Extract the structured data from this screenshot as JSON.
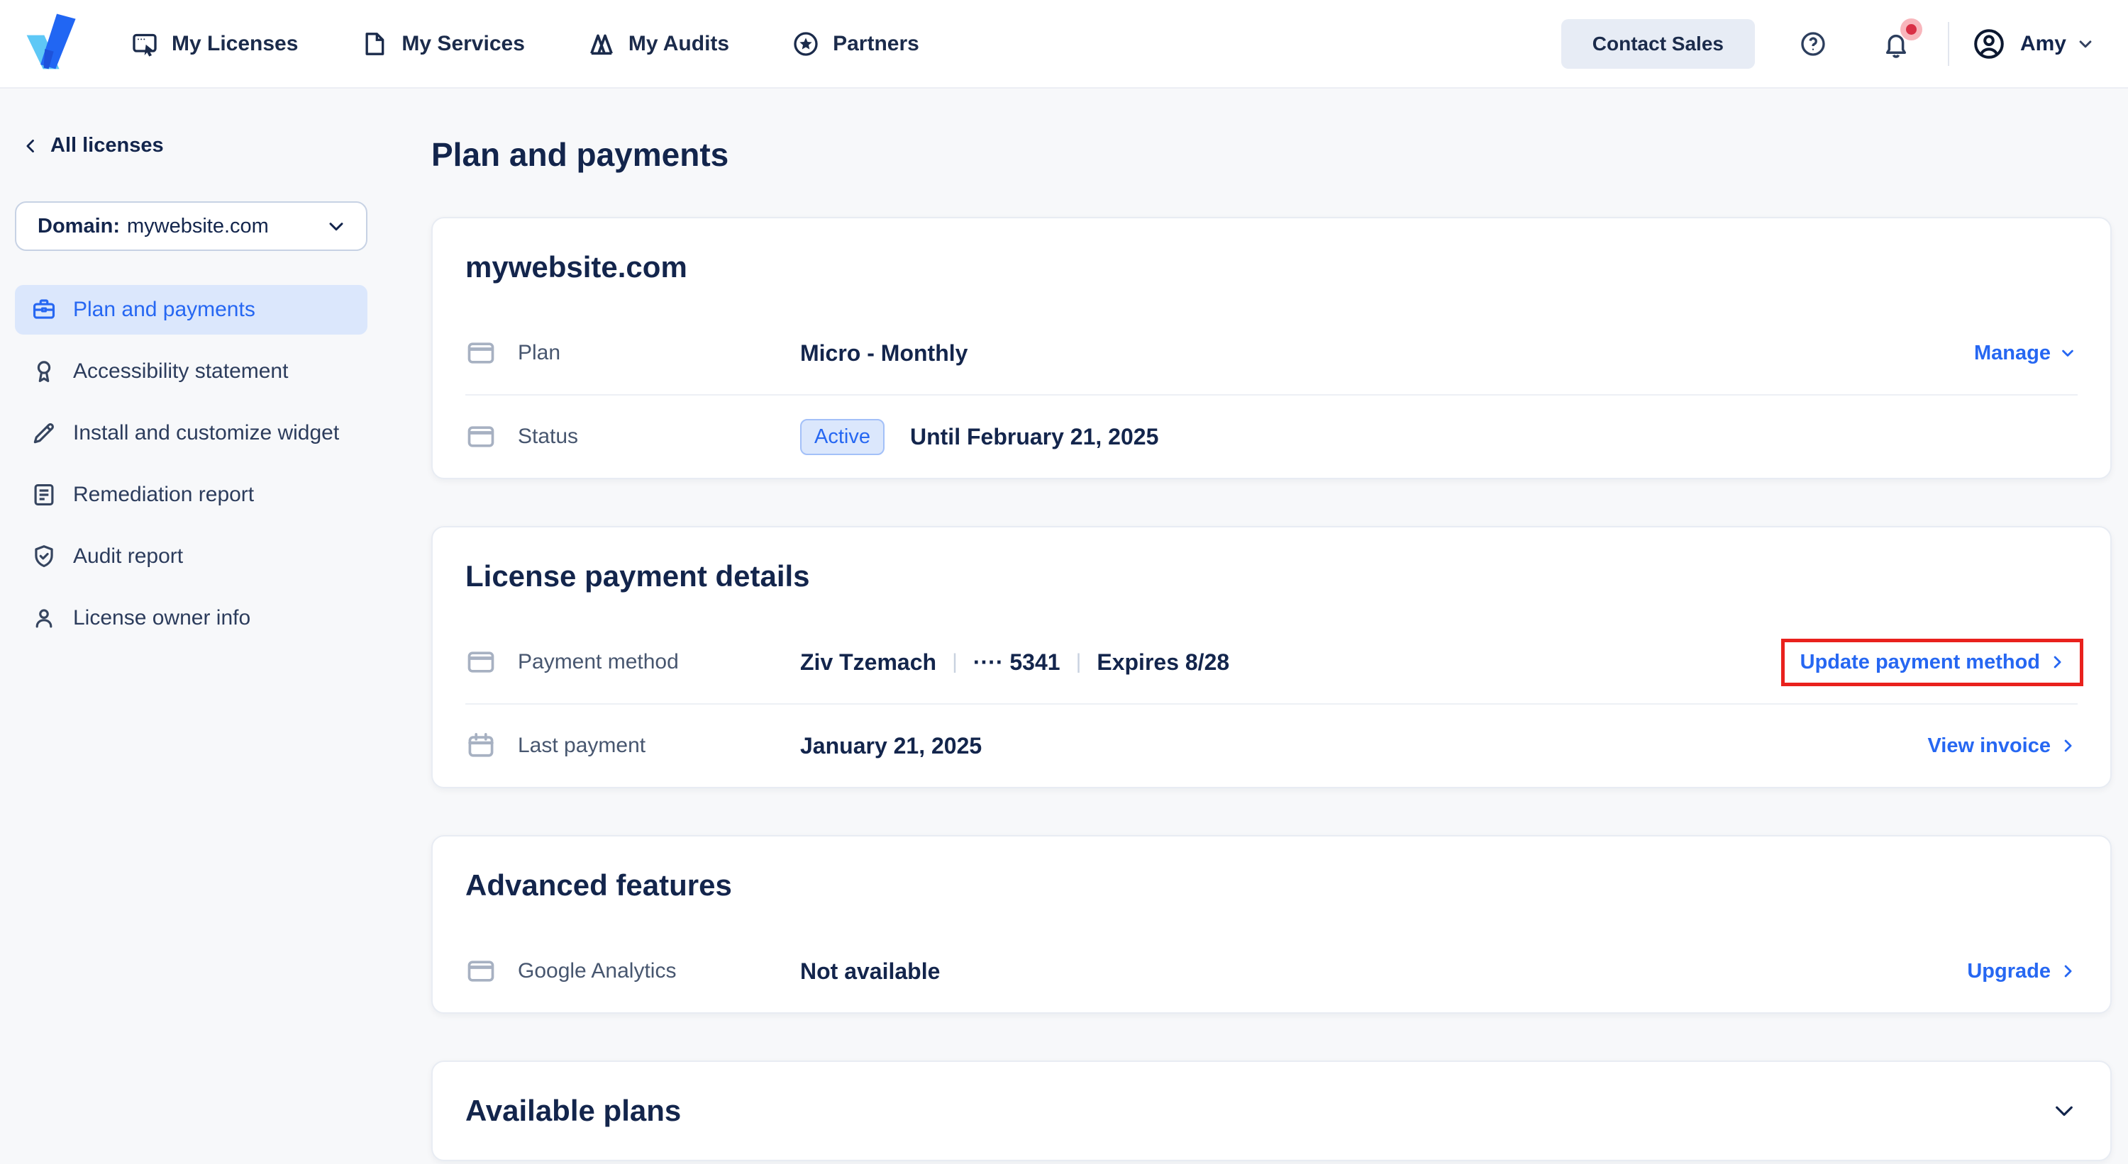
{
  "header": {
    "nav": [
      {
        "label": "My Licenses"
      },
      {
        "label": "My Services"
      },
      {
        "label": "My Audits"
      },
      {
        "label": "Partners"
      }
    ],
    "contact_sales_label": "Contact Sales",
    "user_name": "Amy"
  },
  "sidebar": {
    "back_label": "All licenses",
    "domain": {
      "label": "Domain:",
      "value": "mywebsite.com"
    },
    "items": [
      {
        "label": "Plan and payments",
        "active": true
      },
      {
        "label": "Accessibility statement",
        "active": false
      },
      {
        "label": "Install and customize widget",
        "active": false
      },
      {
        "label": "Remediation report",
        "active": false
      },
      {
        "label": "Audit report",
        "active": false
      },
      {
        "label": "License owner info",
        "active": false
      }
    ]
  },
  "main": {
    "title": "Plan and payments",
    "domain_card": {
      "title": "mywebsite.com",
      "plan_row": {
        "label": "Plan",
        "value": "Micro - Monthly",
        "action": "Manage"
      },
      "status_row": {
        "label": "Status",
        "badge": "Active",
        "value": "Until February 21, 2025"
      }
    },
    "payment_card": {
      "title": "License payment details",
      "payment_method_row": {
        "label": "Payment method",
        "name": "Ziv Tzemach",
        "separator": "|",
        "card_mask": "···· 5341",
        "expires": "Expires 8/28",
        "action": "Update payment method"
      },
      "last_payment_row": {
        "label": "Last payment",
        "value": "January 21, 2025",
        "action": "View invoice"
      }
    },
    "advanced_card": {
      "title": "Advanced features",
      "analytics_row": {
        "label": "Google Analytics",
        "value": "Not available",
        "action": "Upgrade"
      }
    },
    "plans_card": {
      "title": "Available plans"
    }
  },
  "colors": {
    "accent_blue": "#2667f2",
    "navy_text": "#13254c",
    "active_bg": "#dbe7fc",
    "badge_border": "#a3c0f8",
    "annotation_red": "#e9211d",
    "notification_red": "#d92f45",
    "icon_gray": "#a7b1c2",
    "page_bg": "#f7f8fa"
  }
}
